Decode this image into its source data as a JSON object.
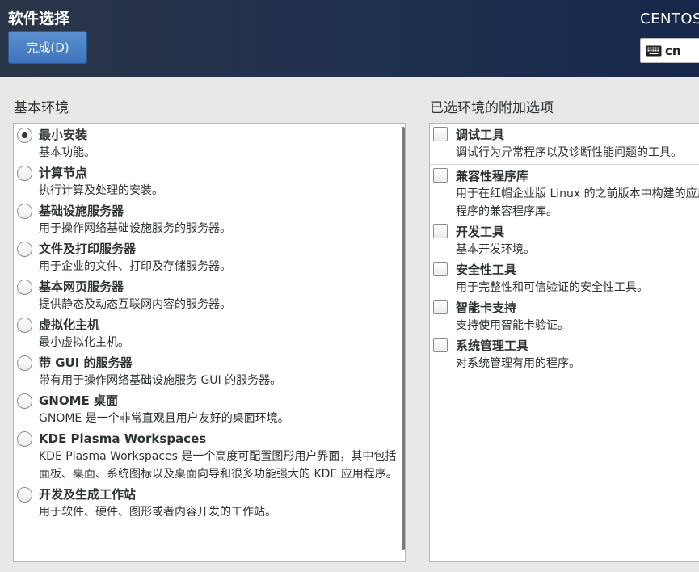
{
  "header": {
    "title": "软件选择",
    "done_label": "完成(D)",
    "product": "CENTOS",
    "keyboard_layout": "cn"
  },
  "left": {
    "heading": "基本环境",
    "selected_index": 0,
    "items": [
      {
        "name": "最小安装",
        "desc": "基本功能。"
      },
      {
        "name": "计算节点",
        "desc": "执行计算及处理的安装。"
      },
      {
        "name": "基础设施服务器",
        "desc": "用于操作网络基础设施服务的服务器。"
      },
      {
        "name": "文件及打印服务器",
        "desc": "用于企业的文件、打印及存储服务器。"
      },
      {
        "name": "基本网页服务器",
        "desc": "提供静态及动态互联网内容的服务器。"
      },
      {
        "name": "虚拟化主机",
        "desc": "最小虚拟化主机。"
      },
      {
        "name": "带 GUI 的服务器",
        "desc": "带有用于操作网络基础设施服务 GUI 的服务器。"
      },
      {
        "name": "GNOME 桌面",
        "desc": "GNOME 是一个非常直观且用户友好的桌面环境。"
      },
      {
        "name": "KDE Plasma Workspaces",
        "desc": "KDE Plasma Workspaces 是一个高度可配置图形用户界面，其中包括面板、桌面、系统图标以及桌面向导和很多功能强大的 KDE 应用程序。"
      },
      {
        "name": "开发及生成工作站",
        "desc": "用于软件、硬件、图形或者内容开发的工作站。"
      }
    ]
  },
  "right": {
    "heading": "已选环境的附加选项",
    "items": [
      {
        "name": "调试工具",
        "desc": "调试行为异常程序以及诊断性能问题的工具。"
      },
      {
        "name": "兼容性程序库",
        "desc": "用于在红帽企业版 Linux 的之前版本中构建的应用程序的兼容程序库。"
      },
      {
        "name": "开发工具",
        "desc": "基本开发环境。"
      },
      {
        "name": "安全性工具",
        "desc": "用于完整性和可信验证的安全性工具。"
      },
      {
        "name": "智能卡支持",
        "desc": "支持使用智能卡验证。"
      },
      {
        "name": "系统管理工具",
        "desc": "对系统管理有用的程序。"
      }
    ]
  }
}
